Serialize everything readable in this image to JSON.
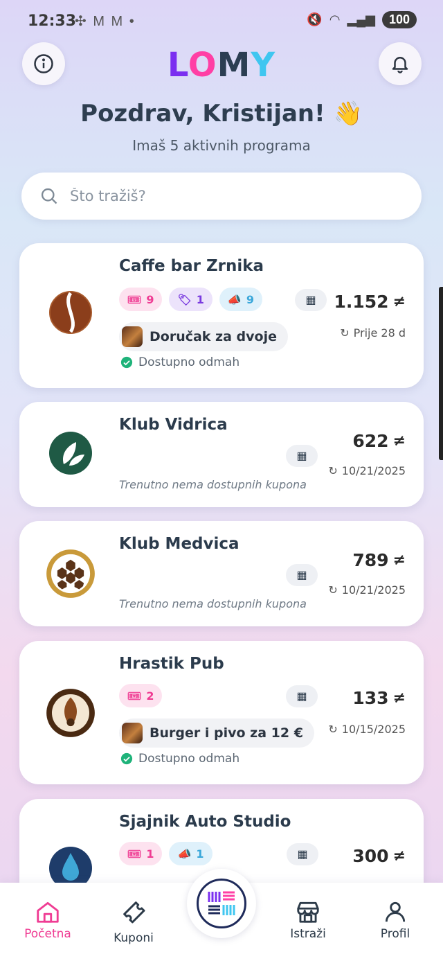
{
  "status_bar": {
    "time": "12:33",
    "battery": "100"
  },
  "app": {
    "logo": [
      "L",
      "O",
      "M",
      "Y"
    ]
  },
  "header": {
    "greeting": "Pozdrav, Kristijan!",
    "wave_emoji": "👋",
    "subtitle": "Imaš 5 aktivnih programa"
  },
  "search": {
    "placeholder": "Što tražiš?"
  },
  "cards": [
    {
      "name": "Caffe bar Zrnika",
      "badges": [
        "9",
        "1",
        "9"
      ],
      "points": "1.152",
      "date": "Prije 28 d",
      "coupon": "Doručak za dvoje",
      "available": "Dostupno odmah"
    },
    {
      "name": "Klub Vidrica",
      "points": "622",
      "date": "10/21/2025",
      "no_coupon": "Trenutno nema dostupnih kupona"
    },
    {
      "name": "Klub Medvica",
      "points": "789",
      "date": "10/21/2025",
      "no_coupon": "Trenutno nema dostupnih kupona"
    },
    {
      "name": "Hrastik Pub",
      "badges": [
        "2"
      ],
      "points": "133",
      "date": "10/15/2025",
      "coupon": "Burger i pivo za 12 €",
      "available": "Dostupno odmah"
    },
    {
      "name": "Sjajnik Auto Studio",
      "badges": [
        "1",
        "1"
      ],
      "points": "300"
    }
  ],
  "nav": {
    "home": "Početna",
    "coupons": "Kuponi",
    "explore": "Istraži",
    "profile": "Profil"
  },
  "colors": {
    "accent_pink": "#ef3c93",
    "accent_purple": "#7b2ff0",
    "accent_blue": "#3fc6f0",
    "navy": "#2c3e52"
  }
}
